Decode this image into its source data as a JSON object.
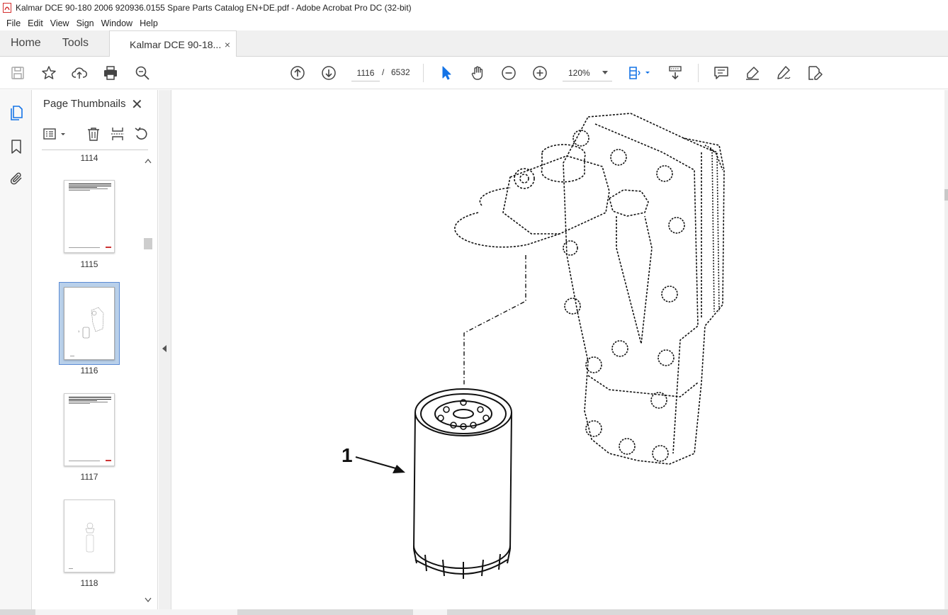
{
  "window": {
    "title": "Kalmar DCE 90-180 2006 920936.0155 Spare Parts Catalog EN+DE.pdf - Adobe Acrobat Pro DC (32-bit)"
  },
  "menu": {
    "items": [
      "File",
      "Edit",
      "View",
      "Sign",
      "Window",
      "Help"
    ]
  },
  "tabs": {
    "home": "Home",
    "tools": "Tools",
    "document": "Kalmar DCE 90-18...",
    "close": "×"
  },
  "toolbar": {
    "current_page": "1116",
    "separator": "/",
    "total_pages": "6532",
    "zoom": "120%"
  },
  "sidebar": {
    "panel_title": "Page Thumbnails",
    "close": "✕",
    "thumbnails": [
      {
        "label": "1114"
      },
      {
        "label": "1115"
      },
      {
        "label": "1116",
        "selected": true
      },
      {
        "label": "1117"
      },
      {
        "label": "1118"
      }
    ]
  },
  "document": {
    "callout_number": "1"
  },
  "colors": {
    "accent": "#1473e6",
    "selection_bg": "#b9d0ea",
    "selection_border": "#5b8bd4"
  }
}
